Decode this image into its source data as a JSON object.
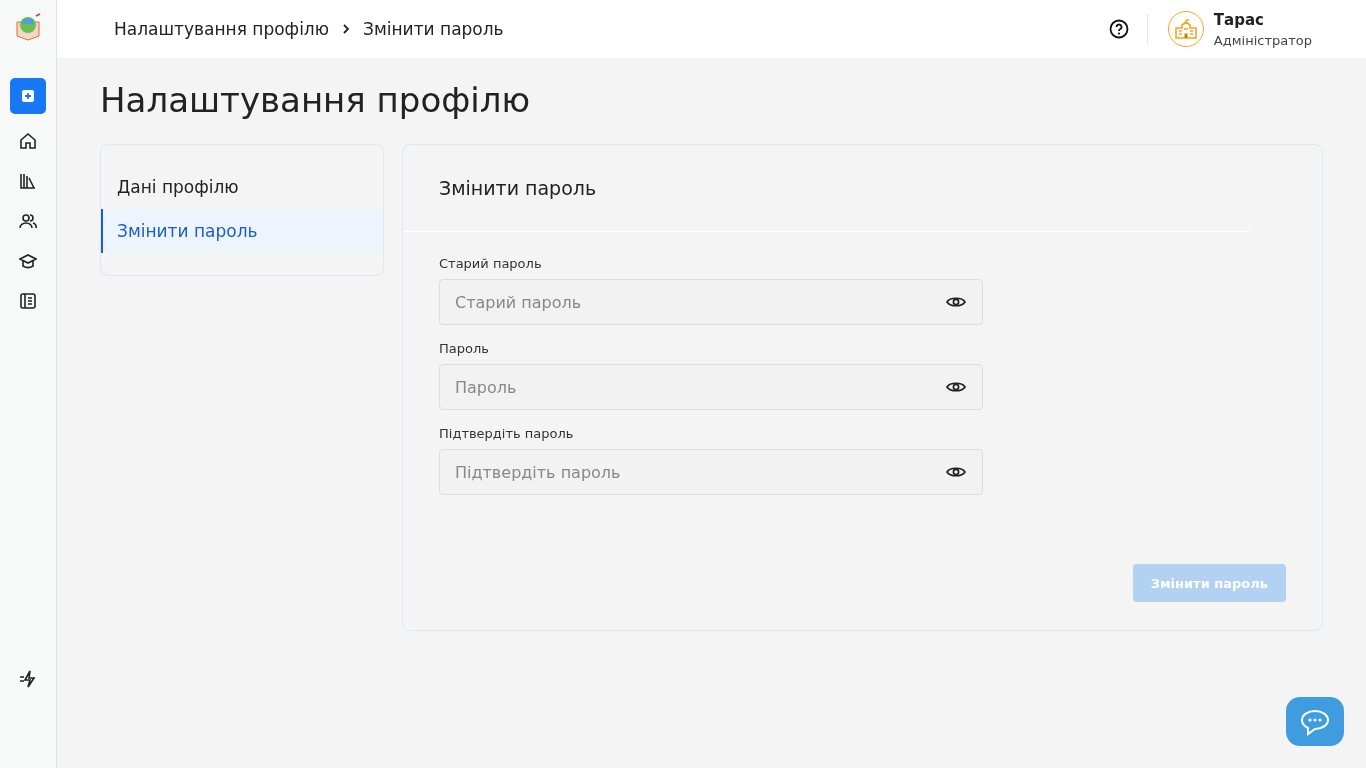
{
  "breadcrumb": [
    {
      "label": "Налаштування профілю"
    },
    {
      "label": "Змінити пароль"
    }
  ],
  "user": {
    "name": "Тарас",
    "role": "Адміністратор"
  },
  "page_title": "Налаштування профілю",
  "settings_menu": [
    {
      "label": "Дані профілю",
      "selected": false
    },
    {
      "label": "Змінити пароль",
      "selected": true
    }
  ],
  "form": {
    "title": "Змінити пароль",
    "fields": [
      {
        "label": "Старий пароль",
        "placeholder": "Старий пароль"
      },
      {
        "label": "Пароль",
        "placeholder": "Пароль"
      },
      {
        "label": "Підтвердіть пароль",
        "placeholder": "Підтвердіть пароль"
      }
    ],
    "submit": {
      "label": "Змінити пароль",
      "disabled": true
    }
  }
}
